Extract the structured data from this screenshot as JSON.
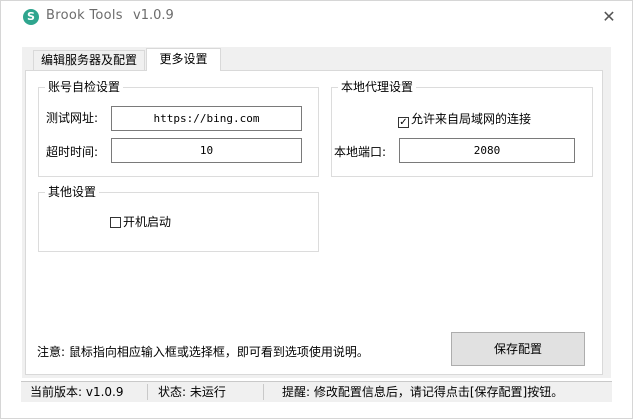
{
  "window": {
    "title": "Brook Tools",
    "version": "v1.0.9",
    "close_glyph": "✕"
  },
  "tabs": [
    {
      "label": "编辑服务器及配置",
      "selected": false
    },
    {
      "label": "更多设置",
      "selected": true
    }
  ],
  "account_check": {
    "title": "账号自检设置",
    "url_label": "测试网址:",
    "url_value": "https://bing.com",
    "timeout_label": "超时时间:",
    "timeout_value": "10"
  },
  "local_proxy": {
    "title": "本地代理设置",
    "allow_lan_label": "允许来自局域网的连接",
    "allow_lan_checked": true,
    "port_label": "本地端口:",
    "port_value": "2080"
  },
  "other": {
    "title": "其他设置",
    "autostart_label": "开机启动",
    "autostart_checked": false
  },
  "note": "注意: 鼠标指向相应输入框或选择框，即可看到选项使用说明。",
  "save_button": "保存配置",
  "statusbar": {
    "version": "当前版本: v1.0.9",
    "state": "状态: 未运行",
    "hint": "提醒: 修改配置信息后，请记得点击[保存配置]按钮。"
  },
  "colors": {
    "app_icon": "#2fa58e",
    "window_bg": "#f0f0f0",
    "panel_bg": "#ffffff"
  }
}
